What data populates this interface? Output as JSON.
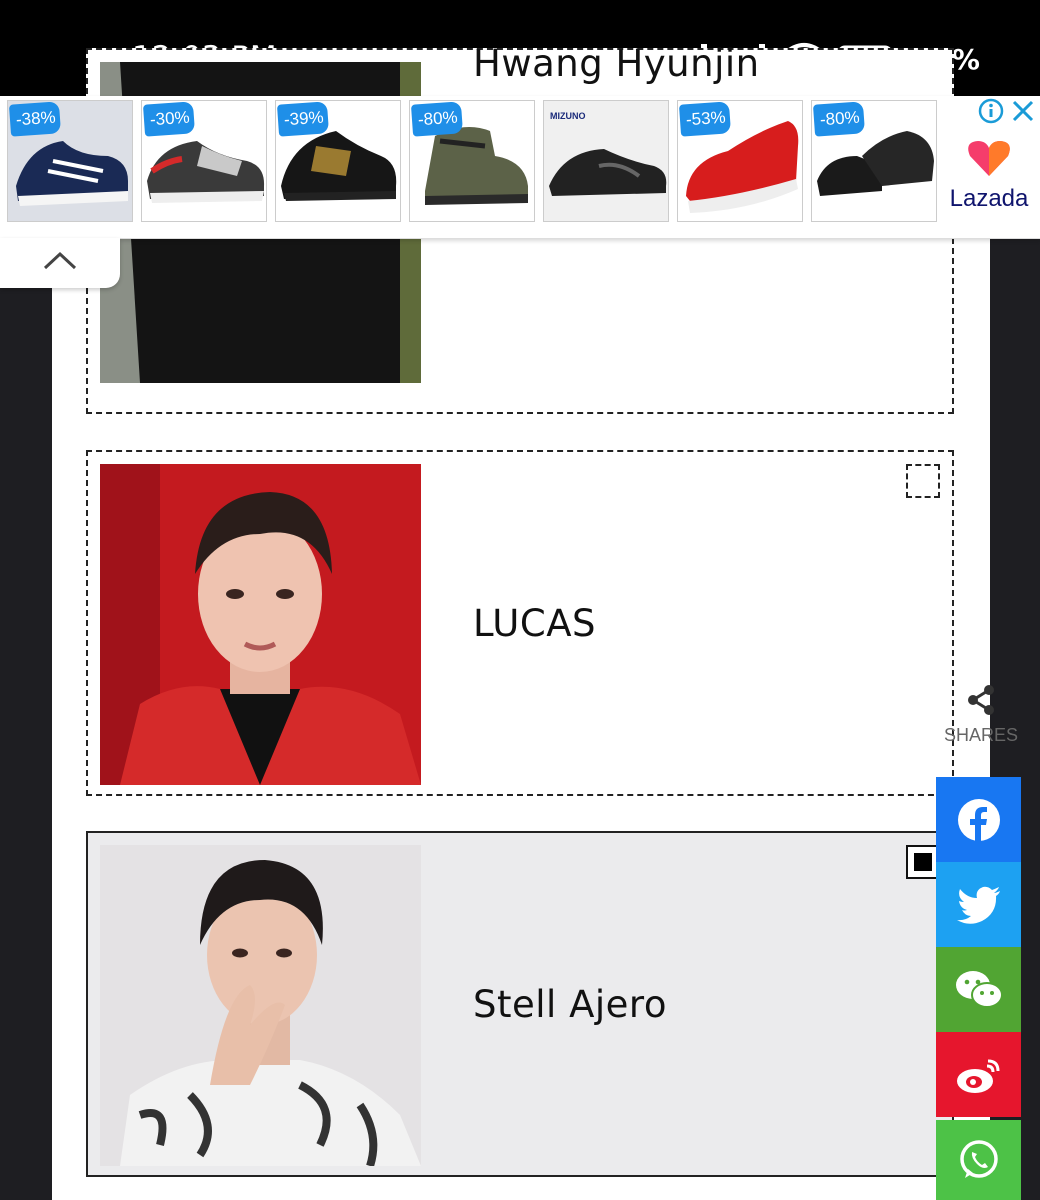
{
  "status_bar": {
    "time": "12:03 PM",
    "battery": "70%"
  },
  "ad": {
    "items": [
      {
        "discount": "-38%",
        "icon": "sneaker-blue"
      },
      {
        "discount": "-30%",
        "icon": "sneaker-white-red"
      },
      {
        "discount": "-39%",
        "icon": "sneaker-black-gold"
      },
      {
        "discount": "-80%",
        "icon": "boot-olive"
      },
      {
        "discount": "",
        "brand": "MIZUNO",
        "icon": "sneaker-black"
      },
      {
        "discount": "-53%",
        "icon": "sneaker-red-knit"
      },
      {
        "discount": "-80%",
        "icon": "shoe-black-leather"
      }
    ],
    "advertiser": "Lazada"
  },
  "cards": [
    {
      "name": "Hwang Hyunjin",
      "checked": false
    },
    {
      "name": "LUCAS",
      "checked": false
    },
    {
      "name": "Stell Ajero",
      "checked": true
    }
  ],
  "share": {
    "label": "SHARES",
    "buttons": [
      {
        "name": "facebook",
        "color": "#1877f2"
      },
      {
        "name": "twitter",
        "color": "#1da1f2"
      },
      {
        "name": "wechat",
        "color": "#51a533"
      },
      {
        "name": "weibo",
        "color": "#e6162d"
      },
      {
        "name": "whatsapp",
        "color": "#4dc247"
      }
    ]
  },
  "colors": {
    "discount_tag": "#1f8fe8",
    "page_bg": "#1e1e22"
  }
}
